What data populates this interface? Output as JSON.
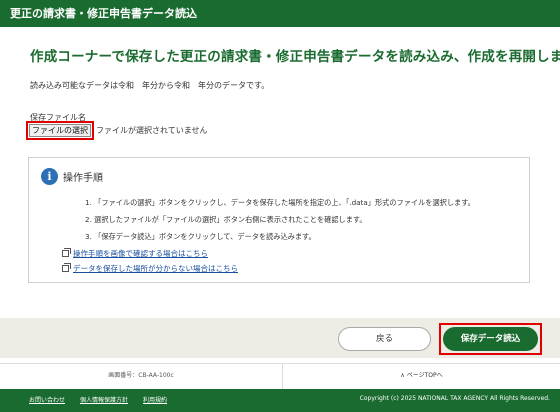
{
  "titlebar": {
    "title": "更正の請求書・修正申告書データ読込"
  },
  "heading": "作成コーナーで保存した更正の請求書・修正申告書データを読み込み、作成を再開します",
  "note": "読み込み可能なデータは令和　年分から令和　年分のデータです。",
  "file": {
    "label": "保存ファイル名",
    "button_label": "ファイルの選択",
    "status": "ファイルが選択されていません"
  },
  "info": {
    "icon": "info-icon",
    "title": "操作手順",
    "steps": [
      "1. 「ファイルの選択」ボタンをクリックし、データを保存した場所を指定の上、「.data」形式のファイルを選択します。",
      "2. 選択したファイルが「ファイルの選択」ボタン右側に表示されたことを確認します。",
      "3. 「保存データ読込」ボタンをクリックして、データを読み込みます。"
    ],
    "links": [
      "操作手順を画像で確認する場合はこちら",
      "データを保存した場所が分からない場合はこちら"
    ]
  },
  "actions": {
    "back_label": "戻る",
    "save_label": "保存データ読込"
  },
  "footer": {
    "screen_no": "画面番号：CB-AA-100c",
    "page_top": "∧ ページTOPへ",
    "links": [
      "お問い合わせ",
      "個人情報保護方針",
      "利用規約"
    ],
    "copyright": "Copyright (c) 2025 NATIONAL TAX AGENCY All Rights Reserved."
  },
  "colors": {
    "brand_green": "#1a6b2f",
    "highlight_red": "#e00000",
    "link_blue": "#1a4fa0",
    "info_blue": "#2c6fb5"
  }
}
